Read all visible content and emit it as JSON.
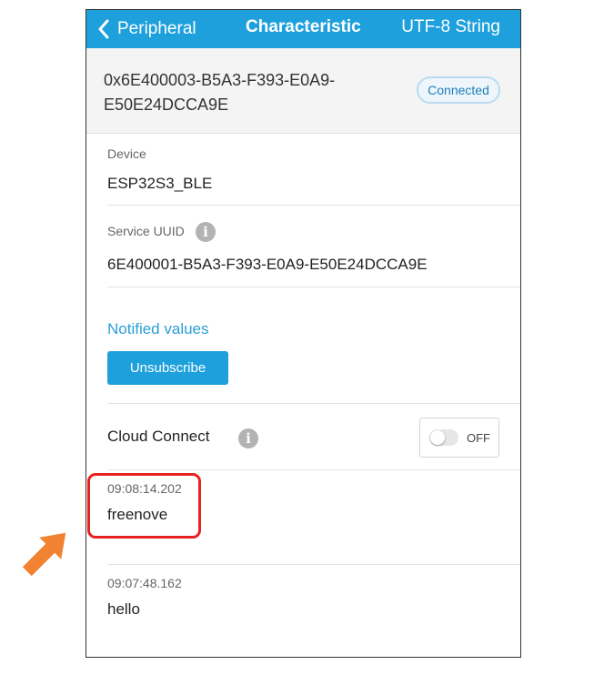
{
  "navbar": {
    "back_label": "Peripheral",
    "title": "Characteristic",
    "right_label": "UTF-8 String"
  },
  "characteristic": {
    "uuid_line1": "0x6E400003-B5A3-F393-E0A9-",
    "uuid_line2": "E50E24DCCA9E",
    "status": "Connected"
  },
  "device": {
    "label": "Device",
    "value": "ESP32S3_BLE"
  },
  "service": {
    "label": "Service UUID",
    "value": "6E400001-B5A3-F393-E0A9-E50E24DCCA9E"
  },
  "notified": {
    "title": "Notified values",
    "button_label": "Unsubscribe"
  },
  "cloud": {
    "label": "Cloud Connect",
    "toggle_label": "OFF"
  },
  "values": [
    {
      "timestamp": "09:08:14.202",
      "text": "freenove"
    },
    {
      "timestamp": "09:07:48.162",
      "text": "hello"
    }
  ],
  "colors": {
    "accent": "#1ea0dc",
    "highlight": "#e8221f",
    "arrow": "#f08232"
  },
  "icons": [
    "chevron-left-icon",
    "info-icon",
    "annotation-arrow-icon"
  ]
}
